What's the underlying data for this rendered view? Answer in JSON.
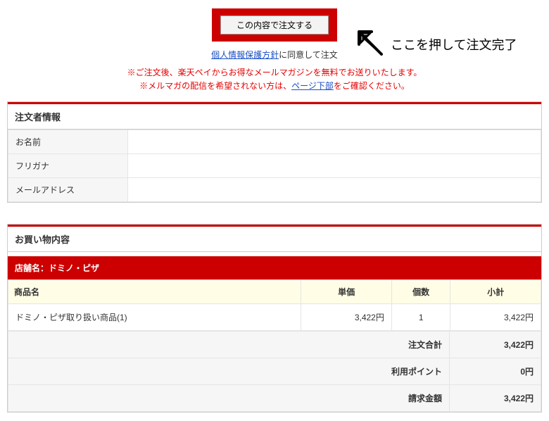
{
  "button": {
    "submit_label": "この内容で注文する"
  },
  "annotation": {
    "text": "ここを押して注文完了"
  },
  "consent": {
    "link": "個人情報保護方針",
    "suffix": "に同意して注文"
  },
  "notice": {
    "line1": "※ご注文後、楽天ペイからお得なメールマガジンを無料でお送りいたします。",
    "line2_prefix": "※メルマガの配信を希望されない方は、",
    "line2_link": "ページ下部",
    "line2_suffix": "をご確認ください。"
  },
  "customer_section": {
    "title": "注文者情報",
    "rows": [
      {
        "label": "お名前",
        "value": ""
      },
      {
        "label": "フリガナ",
        "value": ""
      },
      {
        "label": "メールアドレス",
        "value": ""
      }
    ]
  },
  "items_section": {
    "title": "お買い物内容",
    "shop_label": "店舗名：ドミノ・ピザ",
    "headers": {
      "name": "商品名",
      "unit": "単価",
      "qty": "個数",
      "subtotal": "小計"
    },
    "rows": [
      {
        "name": "ドミノ・ピザ取り扱い商品(1)",
        "unit": "3,422円",
        "qty": "1",
        "subtotal": "3,422円"
      }
    ],
    "summary": [
      {
        "label": "注文合計",
        "value": "3,422円"
      },
      {
        "label": "利用ポイント",
        "value": "0円"
      },
      {
        "label": "請求金額",
        "value": "3,422円"
      }
    ]
  }
}
